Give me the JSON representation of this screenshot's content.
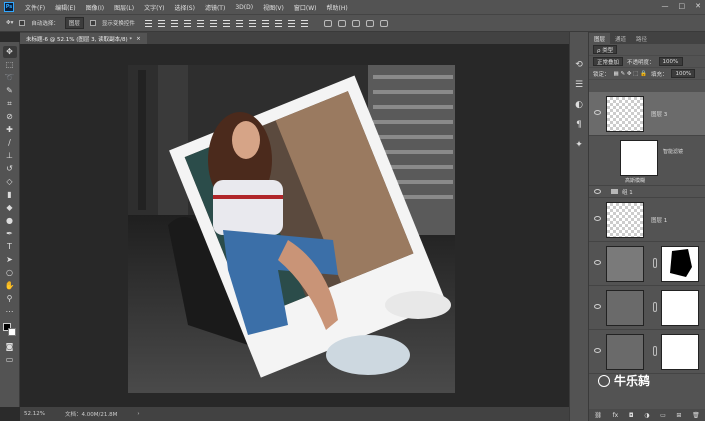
{
  "app": {
    "logo": "Ps"
  },
  "menu": [
    "文件(F)",
    "编辑(E)",
    "图像(I)",
    "图层(L)",
    "文字(Y)",
    "选择(S)",
    "滤镜(T)",
    "3D(D)",
    "视图(V)",
    "窗口(W)",
    "帮助(H)"
  ],
  "window_controls": {
    "minimize": "—",
    "maximize": "□",
    "close": "✕"
  },
  "options": {
    "auto_select_label": "自动选择：",
    "auto_select_value": "图层",
    "show_transform_label": "显示变换控件"
  },
  "document_tabs": [
    {
      "label": "未标题-6 @ 52.1% (图层 3, 读取副本/8) *",
      "close": "×"
    }
  ],
  "status": {
    "zoom": "52.12%",
    "doc": "文档：4.00M/21.8M",
    "arrow": "›"
  },
  "layers_panel": {
    "tabs": [
      "图层",
      "通道",
      "路径"
    ],
    "kind_filter": "ρ 类型",
    "blend_mode": "正常叠加",
    "opacity_label": "不透明度：",
    "opacity_value": "100%",
    "lock_label": "锁定：",
    "fill_label": "填充：",
    "fill_value": "100%",
    "layers": [
      {
        "name": "图层 3",
        "selected": true
      },
      {
        "name": "图层 1",
        "selected": false
      },
      {
        "name": "",
        "selected": false
      },
      {
        "name": "",
        "selected": false
      },
      {
        "name": "",
        "selected": false
      }
    ],
    "effects": {
      "label": "智能滤镜",
      "sub": "高斯模糊"
    },
    "group": {
      "name": "组 1"
    }
  },
  "watermark": {
    "text": "牛乐鸫"
  },
  "colors": {
    "ui_bg": "#535353",
    "workspace": "#282828",
    "accent": "#31a8ff"
  }
}
